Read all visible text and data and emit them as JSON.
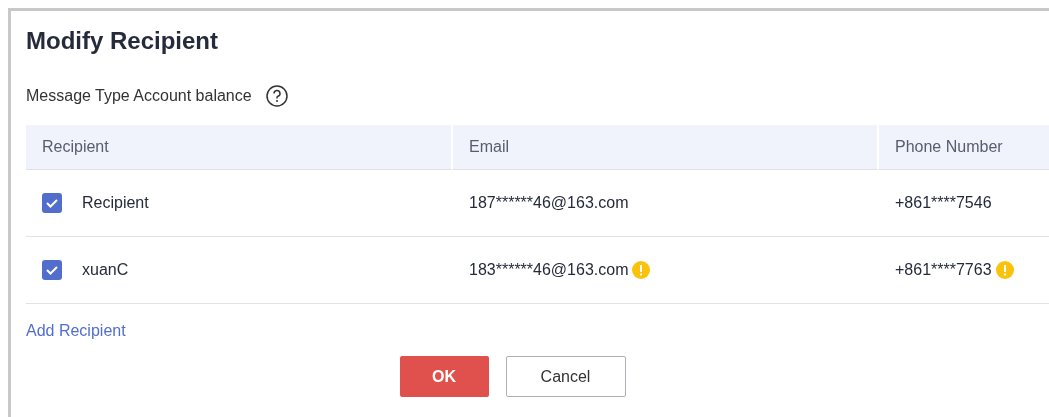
{
  "dialog": {
    "title": "Modify Recipient",
    "message_type": "Message Type Account balance"
  },
  "table": {
    "columns": [
      "Recipient",
      "Email",
      "Phone Number"
    ],
    "rows": [
      {
        "checked": true,
        "name": "Recipient",
        "email": "187******46@163.com",
        "email_warning": false,
        "phone": "+861****7546",
        "phone_warning": false
      },
      {
        "checked": true,
        "name": "xuanC",
        "email": "183******46@163.com",
        "email_warning": true,
        "phone": "+861****7763",
        "phone_warning": true
      }
    ]
  },
  "add_link": "Add Recipient",
  "buttons": {
    "ok": "OK",
    "cancel": "Cancel"
  }
}
